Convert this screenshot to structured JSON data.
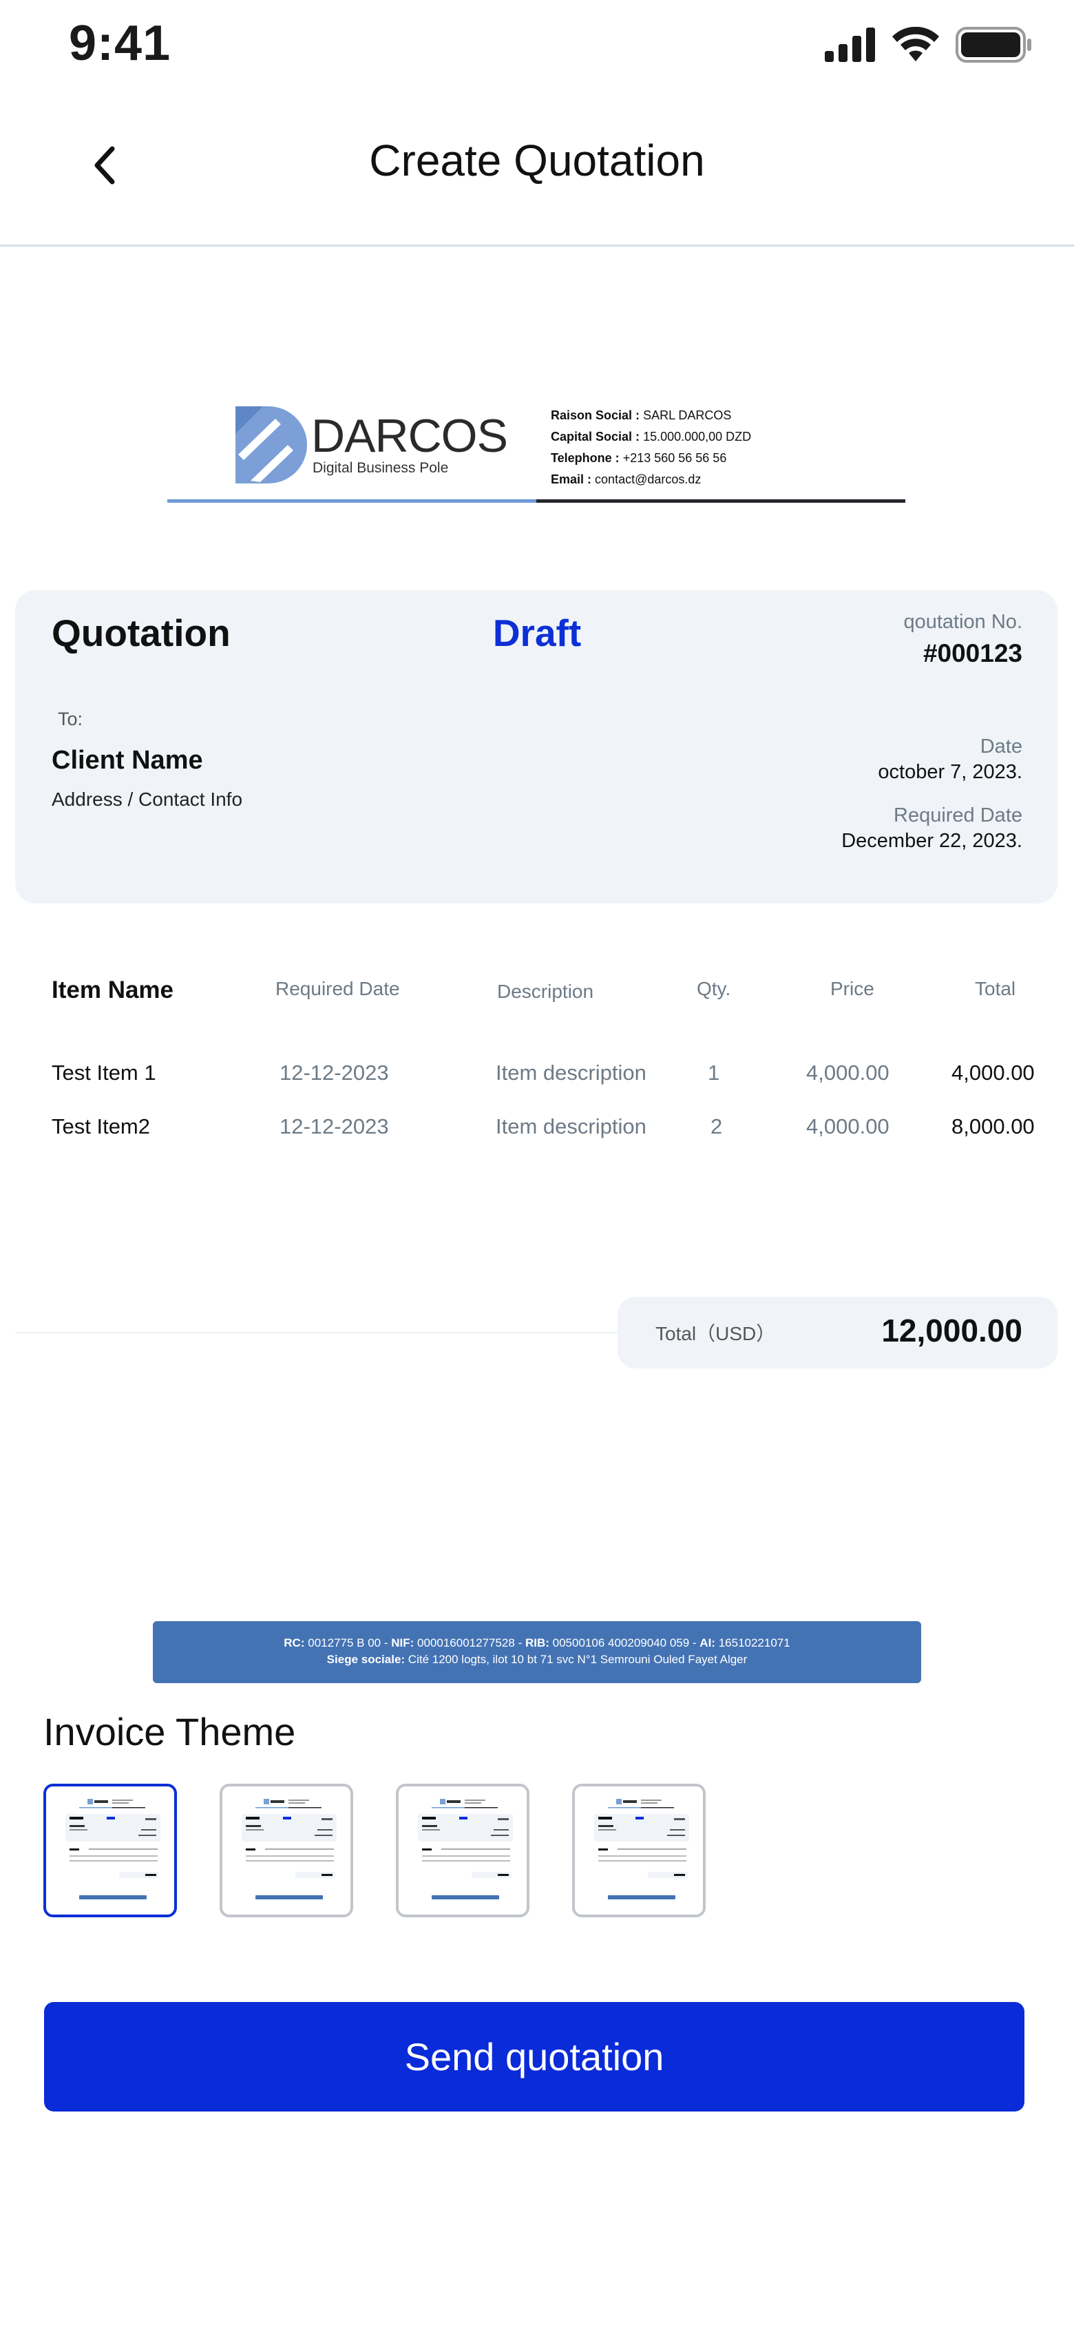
{
  "status_bar": {
    "time": "9:41"
  },
  "header": {
    "title": "Create Quotation"
  },
  "letterhead": {
    "company_name": "DARCOS",
    "tagline": "Digital Business Pole",
    "raison_social_label": "Raison Social :",
    "raison_social": "SARL DARCOS",
    "capital_label": "Capital Social :",
    "capital": "15.000.000,00 DZD",
    "telephone_label": "Telephone :",
    "telephone": "+213 560 56 56 56",
    "email_label": "Email :",
    "email": "contact@darcos.dz",
    "brand_color": "#6e9bd4"
  },
  "quotation": {
    "title": "Quotation",
    "status": "Draft",
    "number_label": "qoutation No.",
    "number": "#000123",
    "to_label": "To:",
    "client_name": "Client Name",
    "client_address": "Address / Contact Info",
    "date_label": "Date",
    "date": "october 7, 2023.",
    "required_date_label": "Required Date",
    "required_date": "December 22, 2023.",
    "status_color": "#0c2fd6"
  },
  "table": {
    "headers": {
      "item": "Item Name",
      "required_date": "Required Date",
      "description": "Description",
      "qty": "Qty.",
      "price": "Price",
      "total": "Total"
    },
    "rows": [
      {
        "item": "Test Item 1",
        "required_date": "12-12-2023",
        "description": "Item description",
        "qty": "1",
        "price": "4,000.00",
        "total": "4,000.00"
      },
      {
        "item": "Test Item2",
        "required_date": "12-12-2023",
        "description": "Item description",
        "qty": "2",
        "price": "4,000.00",
        "total": "8,000.00"
      }
    ]
  },
  "total": {
    "label": "Total（USD）",
    "value": "12,000.00"
  },
  "footer": {
    "rc_label": "RC:",
    "rc": "0012775 B 00",
    "nif_label": "NIF:",
    "nif": "000016001277528",
    "rib_label": "RIB:",
    "rib": "00500106 400209040 059",
    "ai_label": "AI:",
    "ai": "16510221071",
    "siege_label": "Siege sociale:",
    "siege": "Cité 1200 logts, ilot 10 bt 71 svc N°1 Semrouni Ouled Fayet Alger",
    "bar_color": "#4473b4"
  },
  "theme": {
    "title": "Invoice Theme",
    "selected_index": 0,
    "selected_color": "#0c2fd6"
  },
  "actions": {
    "send_label": "Send quotation",
    "send_color": "#0a2bd8"
  }
}
